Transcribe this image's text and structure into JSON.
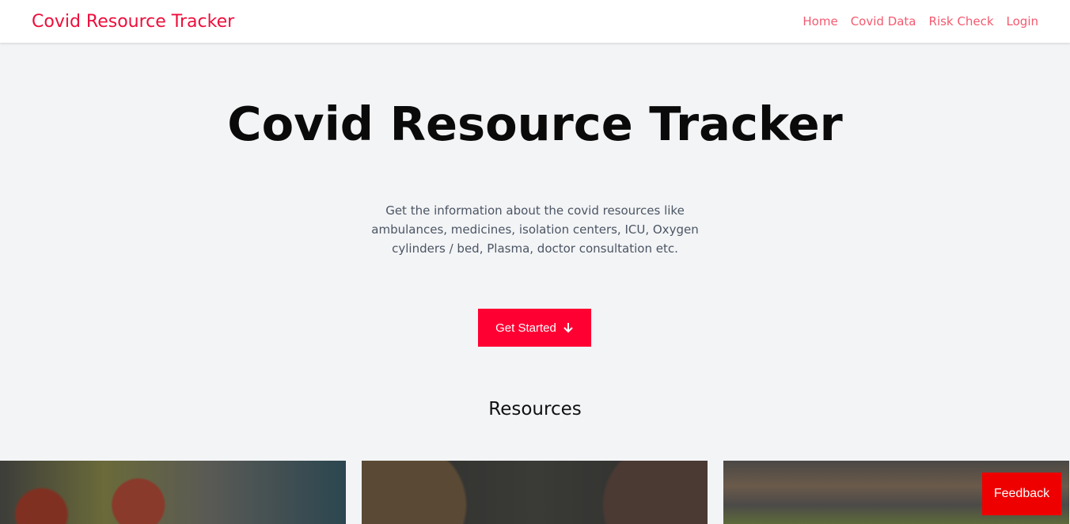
{
  "nav": {
    "brand": "Covid Resource Tracker",
    "links": [
      "Home",
      "Covid Data",
      "Risk Check",
      "Login"
    ]
  },
  "hero": {
    "title": "Covid Resource Tracker",
    "description": "Get the information about the covid resources like ambulances, medicines, isolation centers, ICU, Oxygen cylinders / bed, Plasma, doctor consultation etc.",
    "cta": "Get Started"
  },
  "resources": {
    "heading": "Resources"
  },
  "feedback": "Feedback"
}
